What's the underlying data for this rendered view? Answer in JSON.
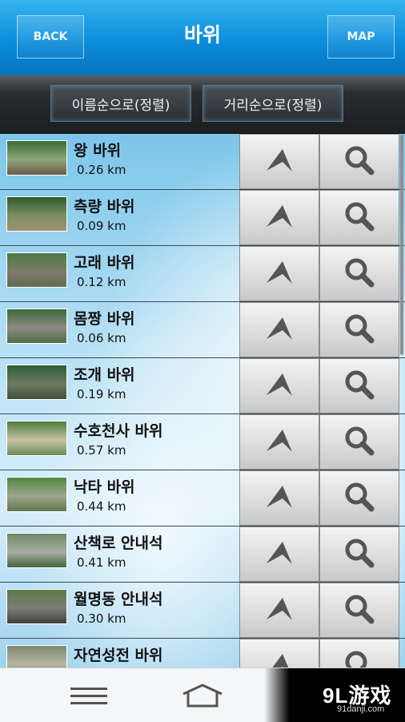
{
  "header": {
    "title": "바위",
    "back_label": "BACK",
    "map_label": "MAP"
  },
  "sort": {
    "by_name": "이름순으로(정렬)",
    "by_distance": "거리순으로(정렬)"
  },
  "rows": [
    {
      "name": "왕 바위",
      "distance": "0.26 km"
    },
    {
      "name": "측량 바위",
      "distance": "0.09 km"
    },
    {
      "name": "고래 바위",
      "distance": "0.12 km"
    },
    {
      "name": "몸짱 바위",
      "distance": "0.06 km"
    },
    {
      "name": "조개 바위",
      "distance": "0.19 km"
    },
    {
      "name": "수호천사 바위",
      "distance": "0.57 km"
    },
    {
      "name": "낙타 바위",
      "distance": "0.44 km"
    },
    {
      "name": "산책로 안내석",
      "distance": "0.41 km"
    },
    {
      "name": "월명동 안내석",
      "distance": "0.30 km"
    },
    {
      "name": "자연성전 바위",
      "distance": ""
    }
  ],
  "icons": {
    "navigate": "navigate-arrow-icon",
    "search": "magnifier-icon",
    "menu": "menu-icon",
    "home": "home-icon"
  },
  "watermark": {
    "logo": "9L游戏",
    "url": "91danji.com"
  },
  "colors": {
    "header_blue": "#0b8ddb",
    "sortbar_dark": "#1c1e20",
    "button_gray": "#dcdcdc"
  }
}
